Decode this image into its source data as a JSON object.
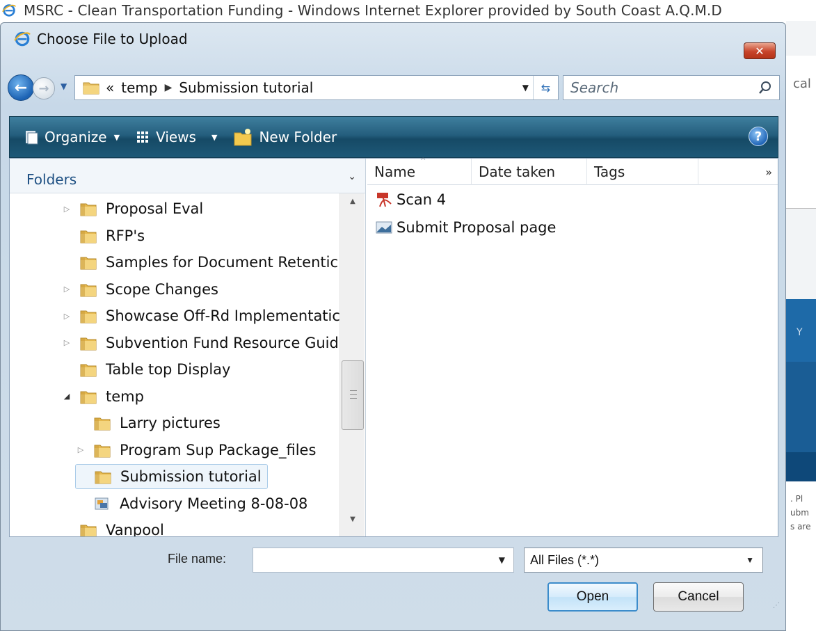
{
  "browser": {
    "title": "MSRC - Clean Transportation Funding - Windows Internet Explorer provided by South Coast A.Q.M.D"
  },
  "background_page": {
    "fragments": [
      "cal",
      "Y",
      ". Pl",
      "ubm",
      "s are"
    ]
  },
  "dialog": {
    "title": "Choose File to Upload",
    "close_label": "✕"
  },
  "address": {
    "overflow": "«",
    "crumbs": [
      "temp",
      "Submission tutorial"
    ],
    "search_placeholder": "Search"
  },
  "toolbar": {
    "organize": "Organize",
    "views": "Views",
    "new_folder": "New Folder",
    "help": "?"
  },
  "folders": {
    "header": "Folders",
    "items": [
      {
        "label": "Proposal Eval",
        "expandable": true
      },
      {
        "label": "RFP's",
        "expandable": false
      },
      {
        "label": "Samples for Document Retentic",
        "expandable": false
      },
      {
        "label": "Scope Changes",
        "expandable": true
      },
      {
        "label": "Showcase Off-Rd Implementatic",
        "expandable": true
      },
      {
        "label": "Subvention Fund Resource Guid",
        "expandable": true
      },
      {
        "label": "Table top Display",
        "expandable": false
      },
      {
        "label": "temp",
        "expandable": true,
        "expanded": true
      },
      {
        "label": "Larry pictures",
        "expandable": false
      },
      {
        "label": "Program Sup Package_files",
        "expandable": true
      },
      {
        "label": "Submission tutorial",
        "expandable": false,
        "selected": true
      },
      {
        "label": "Advisory Meeting 8-08-08",
        "expandable": false
      },
      {
        "label": "Vanpool",
        "expandable": false
      }
    ]
  },
  "files": {
    "columns": [
      "Name",
      "Date taken",
      "Tags"
    ],
    "more": "»",
    "items": [
      {
        "name": "Scan 4",
        "icon": "pdf-icon"
      },
      {
        "name": "Submit Proposal page",
        "icon": "image-file-icon"
      }
    ]
  },
  "bottom": {
    "file_name_label": "File name:",
    "file_name_value": "",
    "file_type": "All Files (*.*)",
    "open_label": "Open",
    "cancel_label": "Cancel"
  },
  "colors": {
    "toolbar": "#245e7d",
    "selection": "#eef5fb",
    "link_blue": "#1d4f82"
  }
}
